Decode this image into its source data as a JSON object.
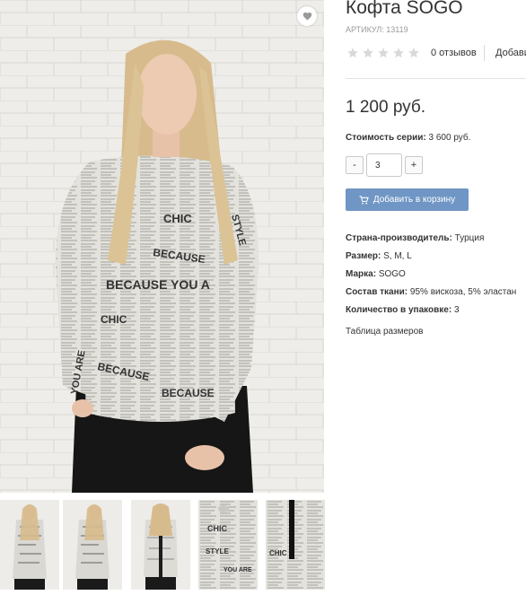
{
  "product": {
    "title": "Кофта SOGO",
    "sku": "АРТИКУЛ: 13119",
    "rating_stars": 0,
    "rating_max": 5,
    "reviews": "0 отзывов",
    "add_review": "Добавить",
    "price": "1 200 руб.",
    "series_label": "Стоимость серии:",
    "series_value": "3 600 руб.",
    "qty_minus": "-",
    "qty_value": "3",
    "qty_plus": "+",
    "cart_button": "Добавить в корзину",
    "size_table_link": "Таблица размеров"
  },
  "specs": [
    {
      "label": "Страна-производитель:",
      "value": "Турция"
    },
    {
      "label": "Размер:",
      "value": "S, M, L"
    },
    {
      "label": "Марка:",
      "value": "SOGO"
    },
    {
      "label": "Состав ткани:",
      "value": "95% вискоза, 5% эластан"
    },
    {
      "label": "Количество в упаковке:",
      "value": "3"
    }
  ],
  "print_words": {
    "chic": "CHIC",
    "because": "BECAUSE",
    "because_you": "BECAUSE YOU A",
    "style": "STYLE",
    "you_are": "YOU ARE"
  },
  "icons": {
    "favorite": "heart-icon",
    "cart": "cart-icon",
    "rating": "star-icon"
  },
  "colors": {
    "cart_button": "#6f96c4",
    "star_empty": "#d9d9d9",
    "wall": "#ecebe8"
  }
}
